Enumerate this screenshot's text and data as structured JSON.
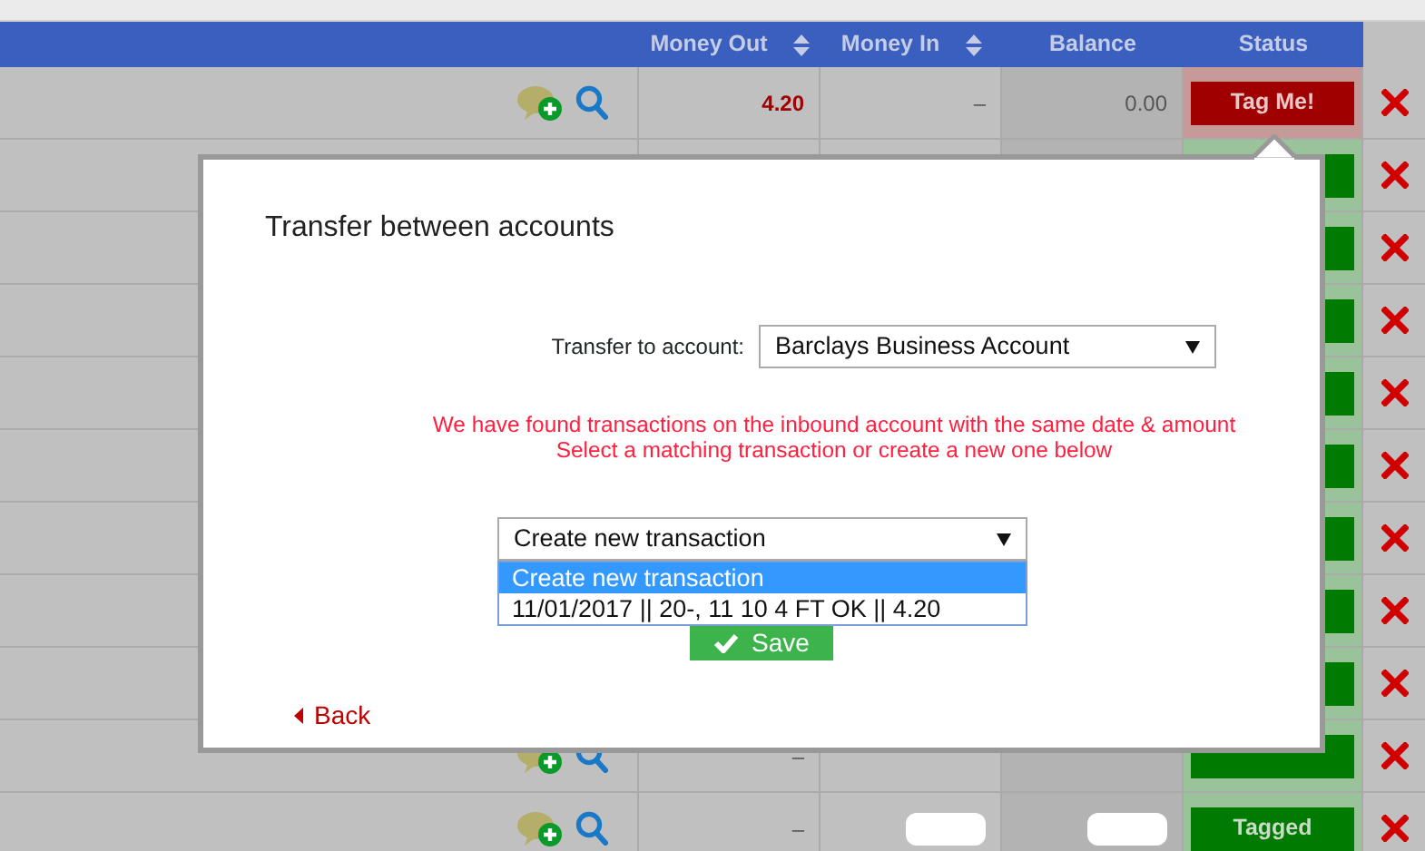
{
  "table": {
    "columns": [
      {
        "label": "Money Out",
        "sortable": true
      },
      {
        "label": "Money In",
        "sortable": true
      },
      {
        "label": "Balance",
        "sortable": false
      },
      {
        "label": "Status",
        "sortable": false
      }
    ],
    "rows": [
      {
        "kind": "full",
        "money_out": "4.20",
        "money_in": "–",
        "balance": "0.00",
        "status": {
          "kind": "tag_me",
          "label": "Tag Me!"
        }
      },
      {
        "kind": "covered",
        "status": {
          "kind": "tagged"
        }
      },
      {
        "kind": "covered",
        "status": {
          "kind": "tagged"
        }
      },
      {
        "kind": "covered",
        "status": {
          "kind": "tagged"
        }
      },
      {
        "kind": "covered",
        "status": {
          "kind": "tagged"
        }
      },
      {
        "kind": "covered",
        "status": {
          "kind": "tagged"
        }
      },
      {
        "kind": "covered",
        "status": {
          "kind": "tagged"
        }
      },
      {
        "kind": "covered",
        "status": {
          "kind": "tagged"
        }
      },
      {
        "kind": "covered",
        "status": {
          "kind": "tagged"
        }
      },
      {
        "kind": "full",
        "money_out": "–",
        "status": {
          "kind": "tagged"
        }
      },
      {
        "kind": "full",
        "money_out": "–",
        "money_in_redacted": true,
        "balance_redacted": true,
        "status": {
          "kind": "tagged",
          "label": "Tagged"
        }
      }
    ]
  },
  "modal": {
    "title": "Transfer between accounts",
    "account_label": "Transfer to account:",
    "account_value": "Barclays Business Account",
    "message": [
      "We have found transactions on the inbound account with the same date & amount",
      "Select a matching transaction or create a new one below"
    ],
    "transaction_select": {
      "value": "Create new transaction",
      "options": [
        {
          "label": "Create new transaction",
          "selected": true
        },
        {
          "label": "11/01/2017 || 20-, 11 10 4 FT OK || 4.20",
          "selected": false
        }
      ]
    },
    "save_button": "Save",
    "back_link": "Back"
  }
}
